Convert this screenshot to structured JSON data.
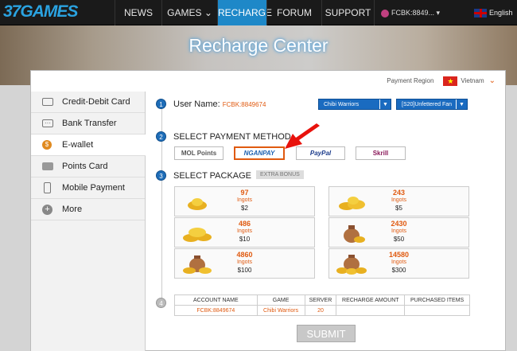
{
  "nav": {
    "logo_left": "37",
    "logo_right": "GAMES",
    "items": [
      "NEWS",
      "GAMES",
      "RECHARGE",
      "FORUM",
      "SUPPORT"
    ],
    "user": "FCBK:8849...",
    "language": "English"
  },
  "banner": {
    "title": "Recharge Center"
  },
  "region": {
    "label": "Payment Region",
    "value": "Vietnam"
  },
  "sidebar": {
    "items": [
      {
        "label": "Credit-Debit Card",
        "icon": "credit-card-icon"
      },
      {
        "label": "Bank Transfer",
        "icon": "bank-icon"
      },
      {
        "label": "E-wallet",
        "icon": "wallet-icon"
      },
      {
        "label": "Points Card",
        "icon": "points-card-icon"
      },
      {
        "label": "Mobile Payment",
        "icon": "mobile-icon"
      },
      {
        "label": "More",
        "icon": "plus-icon"
      }
    ]
  },
  "step1": {
    "num": "1",
    "label": "User Name:",
    "username": "FCBK:8849674",
    "game": "Chibi Warriors",
    "server": "[S20]Unfettered Fan"
  },
  "step2": {
    "num": "2",
    "label": "SELECT PAYMENT METHOD",
    "methods": [
      "MOL Points",
      "NGANPAY",
      "PayPal",
      "Skrill"
    ]
  },
  "step3": {
    "num": "3",
    "label": "SELECT PACKAGE",
    "badge": "EXTRA BONUS",
    "packages": [
      {
        "amount": "97",
        "unit": "Ingots",
        "price": "$2"
      },
      {
        "amount": "243",
        "unit": "Ingots",
        "price": "$5"
      },
      {
        "amount": "486",
        "unit": "Ingots",
        "price": "$10"
      },
      {
        "amount": "2430",
        "unit": "Ingots",
        "price": "$50"
      },
      {
        "amount": "4860",
        "unit": "Ingots",
        "price": "$100"
      },
      {
        "amount": "14580",
        "unit": "Ingots",
        "price": "$300"
      }
    ]
  },
  "step4": {
    "num": "4",
    "headers": [
      "ACCOUNT NAME",
      "GAME",
      "SERVER",
      "RECHARGE AMOUNT",
      "PURCHASED ITEMS"
    ],
    "row": [
      "FCBK:8849674",
      "Chibi Warriors",
      "20",
      "",
      ""
    ]
  },
  "submit": "SUBMIT"
}
